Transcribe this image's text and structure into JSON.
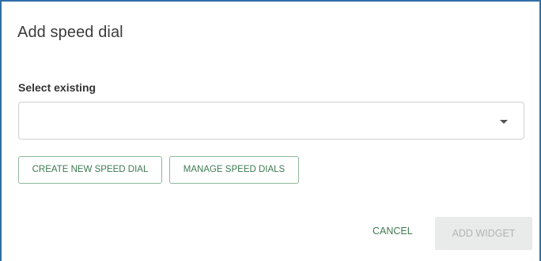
{
  "dialog": {
    "title": "Add speed dial",
    "select_label": "Select existing",
    "select_value": "",
    "create_button": "CREATE NEW SPEED DIAL",
    "manage_button": "MANAGE SPEED DIALS",
    "cancel_button": "CANCEL",
    "add_widget_button": "ADD WIDGET",
    "add_widget_disabled": true
  },
  "colors": {
    "accent": "#3d7a52",
    "frame": "#2f6fa7",
    "disabled_bg": "#e9eaea",
    "disabled_text": "#b3b3b3"
  },
  "icons": {
    "select_caret": "chevron-down-icon"
  }
}
